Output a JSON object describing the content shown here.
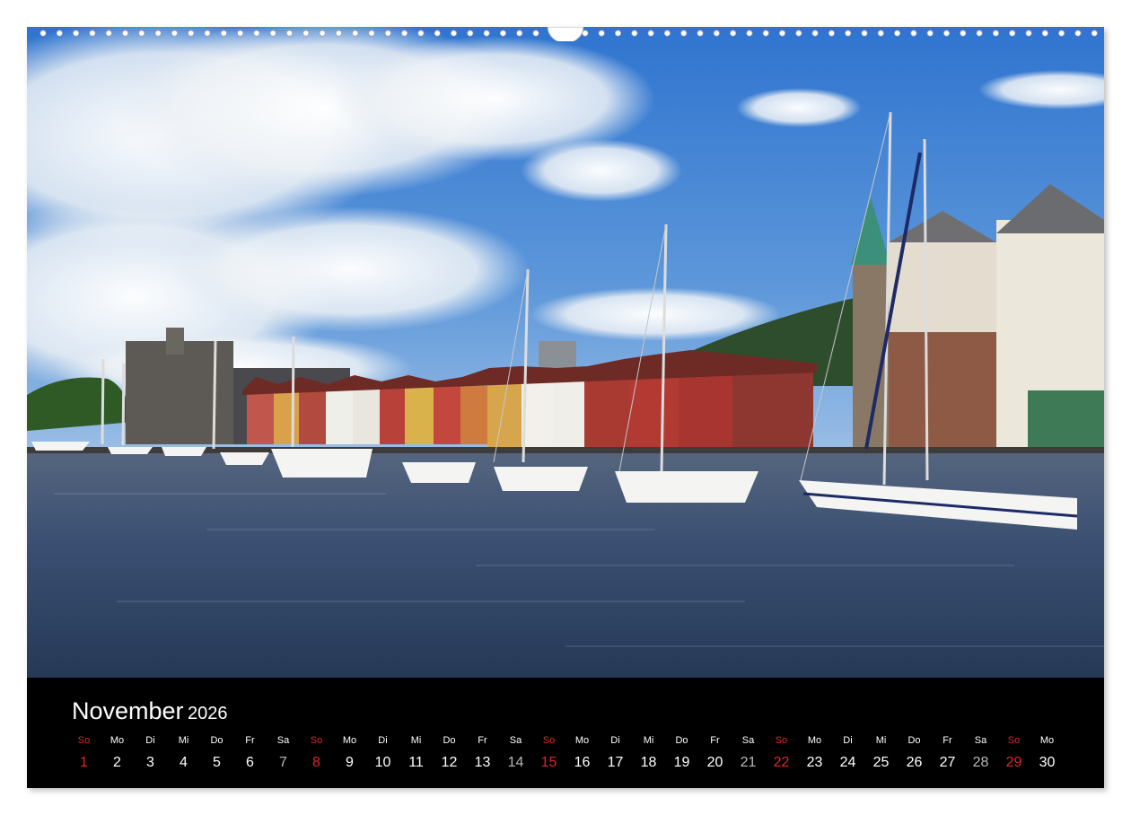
{
  "calendar": {
    "month": "November",
    "year": "2026",
    "sunday_color": "#e0262c",
    "saturday_number_color": "#b8b8b8",
    "days": [
      {
        "dow": "So",
        "num": "1",
        "type": "sunday"
      },
      {
        "dow": "Mo",
        "num": "2",
        "type": "weekday"
      },
      {
        "dow": "Di",
        "num": "3",
        "type": "weekday"
      },
      {
        "dow": "Mi",
        "num": "4",
        "type": "weekday"
      },
      {
        "dow": "Do",
        "num": "5",
        "type": "weekday"
      },
      {
        "dow": "Fr",
        "num": "6",
        "type": "weekday"
      },
      {
        "dow": "Sa",
        "num": "7",
        "type": "saturday"
      },
      {
        "dow": "So",
        "num": "8",
        "type": "sunday"
      },
      {
        "dow": "Mo",
        "num": "9",
        "type": "weekday"
      },
      {
        "dow": "Di",
        "num": "10",
        "type": "weekday"
      },
      {
        "dow": "Mi",
        "num": "11",
        "type": "weekday"
      },
      {
        "dow": "Do",
        "num": "12",
        "type": "weekday"
      },
      {
        "dow": "Fr",
        "num": "13",
        "type": "weekday"
      },
      {
        "dow": "Sa",
        "num": "14",
        "type": "saturday"
      },
      {
        "dow": "So",
        "num": "15",
        "type": "sunday"
      },
      {
        "dow": "Mo",
        "num": "16",
        "type": "weekday"
      },
      {
        "dow": "Di",
        "num": "17",
        "type": "weekday"
      },
      {
        "dow": "Mi",
        "num": "18",
        "type": "weekday"
      },
      {
        "dow": "Do",
        "num": "19",
        "type": "weekday"
      },
      {
        "dow": "Fr",
        "num": "20",
        "type": "weekday"
      },
      {
        "dow": "Sa",
        "num": "21",
        "type": "saturday"
      },
      {
        "dow": "So",
        "num": "22",
        "type": "sunday"
      },
      {
        "dow": "Mo",
        "num": "23",
        "type": "weekday"
      },
      {
        "dow": "Di",
        "num": "24",
        "type": "weekday"
      },
      {
        "dow": "Mi",
        "num": "25",
        "type": "weekday"
      },
      {
        "dow": "Do",
        "num": "26",
        "type": "weekday"
      },
      {
        "dow": "Fr",
        "num": "27",
        "type": "weekday"
      },
      {
        "dow": "Sa",
        "num": "28",
        "type": "saturday"
      },
      {
        "dow": "So",
        "num": "29",
        "type": "sunday"
      },
      {
        "dow": "Mo",
        "num": "30",
        "type": "weekday"
      }
    ]
  },
  "photo": {
    "subject": "harbour-with-sailboats-and-wooden-houses",
    "sky_color": "#3a7fd0",
    "water_color": "#3b4f6e"
  },
  "binding": {
    "icon": "spiral-binding-holes"
  }
}
